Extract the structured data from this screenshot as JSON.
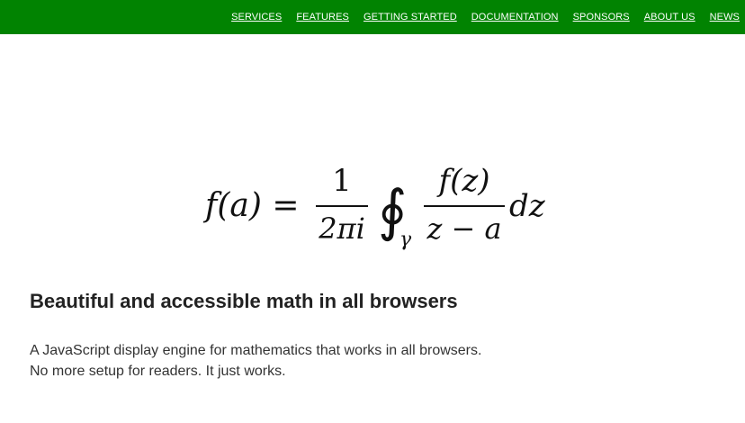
{
  "nav": {
    "items": [
      {
        "label": "SERVICES"
      },
      {
        "label": "FEATURES"
      },
      {
        "label": "GETTING STARTED"
      },
      {
        "label": "DOCUMENTATION"
      },
      {
        "label": "SPONSORS"
      },
      {
        "label": "ABOUT US"
      },
      {
        "label": "NEWS"
      }
    ]
  },
  "formula": {
    "lhs": "f(a) =",
    "numerator": "1",
    "denominator": "2πi",
    "integral": "∮",
    "subscript": "γ",
    "integrand_numerator": "f(z)",
    "integrand_denominator": "z − a",
    "differential": "dz"
  },
  "hero": {
    "heading": "Beautiful and accessible math in all browsers",
    "line1": "A JavaScript display engine for mathematics that works in all browsers.",
    "line2": "No more setup for readers. It just works."
  },
  "colors": {
    "header_bg": "#018301",
    "nav_text": "#ffffff"
  }
}
